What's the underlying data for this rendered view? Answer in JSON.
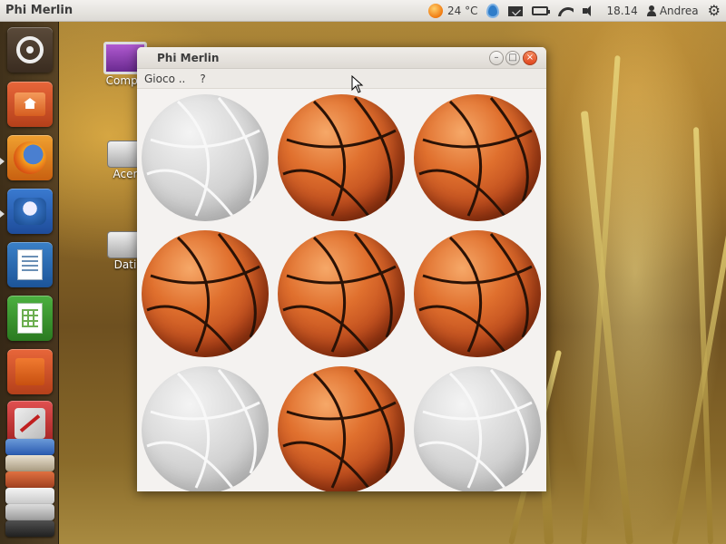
{
  "top_panel": {
    "app_title": "Phi Merlin",
    "weather": "24 °C",
    "clock": "18.14",
    "user": "Andrea"
  },
  "desktop_icons": [
    {
      "label": "Compu"
    },
    {
      "label": "Acer"
    },
    {
      "label": "Dati"
    }
  ],
  "window": {
    "title": "Phi Merlin",
    "menu": [
      "Gioco ..",
      "?"
    ],
    "buttons": [
      "minimize",
      "maximize",
      "close"
    ]
  },
  "board": {
    "rows": 3,
    "cols": 3,
    "cells": [
      [
        "off",
        "on",
        "on"
      ],
      [
        "on",
        "on",
        "on"
      ],
      [
        "off",
        "on",
        "off"
      ]
    ]
  },
  "colors": {
    "ball_on": "#d8642a",
    "ball_off": "#d0d0d0",
    "window_bg": "#f4f2f0",
    "close_button": "#e65a2e"
  }
}
